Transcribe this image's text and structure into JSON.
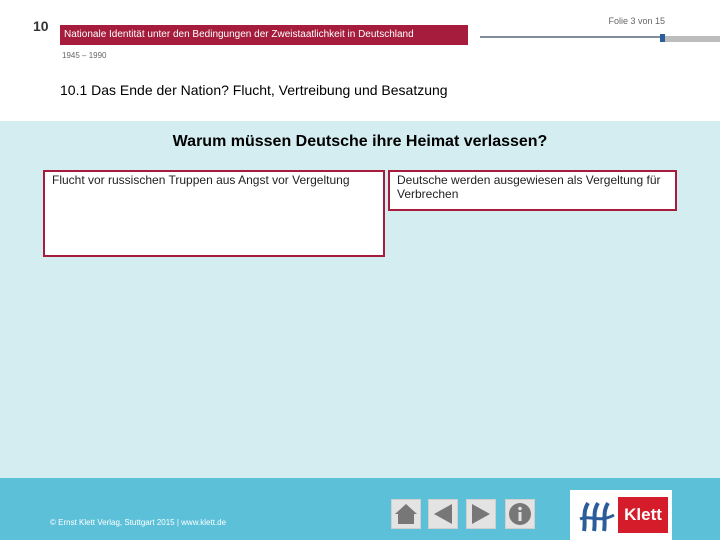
{
  "header": {
    "chapter_number": "10",
    "slide_counter": "Folie 3 von 15",
    "title": "Nationale Identität unter den Bedingungen der Zweistaatlichkeit in Deutschland",
    "years": "1945 – 1990",
    "section_title": "10.1 Das Ende der Nation? Flucht, Vertreibung und Besatzung"
  },
  "main": {
    "question": "Warum müssen Deutsche ihre Heimat verlassen?",
    "answers": [
      "Flucht vor russischen Truppen aus Angst vor Vergeltung",
      "Deutsche werden ausgewiesen als Vergeltung für Verbrechen"
    ]
  },
  "footer": {
    "copyright": "© Ernst Klett Verlag, Stuttgart 2015 | www.klett.de",
    "nav_icons": [
      "home-icon",
      "previous-icon",
      "next-icon",
      "info-icon"
    ],
    "logo_text": "Klett"
  },
  "colors": {
    "accent": "#a51c3c",
    "background": "#d3edf1",
    "footer": "#5bc0d8",
    "logo_red": "#d41c2b"
  }
}
